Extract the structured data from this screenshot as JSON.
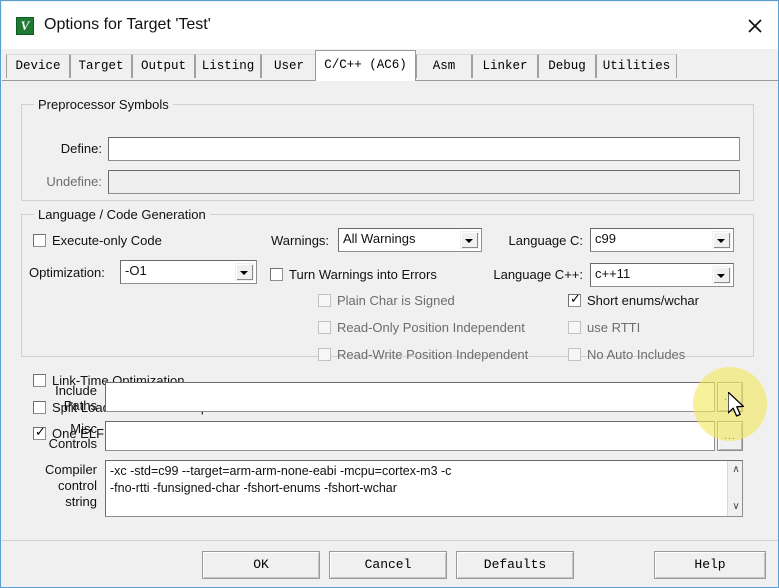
{
  "window": {
    "title": "Options for Target 'Test'",
    "icon_name": "uvision-app-icon",
    "icon_glyph": "V",
    "close_label": "✕",
    "accent_border": "#5a9fd4"
  },
  "tabs": [
    {
      "label": "Device",
      "active": false
    },
    {
      "label": "Target",
      "active": false
    },
    {
      "label": "Output",
      "active": false
    },
    {
      "label": "Listing",
      "active": false
    },
    {
      "label": "User",
      "active": false
    },
    {
      "label": "C/C++ (AC6)",
      "active": true
    },
    {
      "label": "Asm",
      "active": false
    },
    {
      "label": "Linker",
      "active": false
    },
    {
      "label": "Debug",
      "active": false
    },
    {
      "label": "Utilities",
      "active": false
    }
  ],
  "preprocessor": {
    "group_label": "Preprocessor Symbols",
    "define_label": "Define:",
    "define_value": "",
    "undefine_label": "Undefine:",
    "undefine_value": ""
  },
  "language": {
    "group_label": "Language / Code Generation",
    "execute_only_code": {
      "label": "Execute-only Code",
      "checked": false,
      "enabled": true
    },
    "optimization_label": "Optimization:",
    "optimization_value": "-O1",
    "link_time_optimization": {
      "label": "Link-Time Optimization",
      "checked": false,
      "enabled": true
    },
    "split_load_store": {
      "label": "Split Load and Store Multiple",
      "checked": false,
      "enabled": true
    },
    "one_elf_section": {
      "label": "One ELF Section per Function",
      "checked": true,
      "enabled": true
    },
    "warnings_label": "Warnings:",
    "warnings_value": "All Warnings",
    "turn_warnings_into_errors": {
      "label": "Turn Warnings into Errors",
      "checked": false,
      "enabled": true
    },
    "plain_char_is_signed": {
      "label": "Plain Char is Signed",
      "checked": false,
      "enabled": false
    },
    "read_only_position_independent": {
      "label": "Read-Only Position Independent",
      "checked": false,
      "enabled": false
    },
    "read_write_position_independent": {
      "label": "Read-Write Position Independent",
      "checked": false,
      "enabled": false
    },
    "language_c_label": "Language C:",
    "language_c_value": "c99",
    "language_cpp_label": "Language C++:",
    "language_cpp_value": "c++11",
    "short_enums_wchar": {
      "label": "Short enums/wchar",
      "checked": true,
      "enabled": true
    },
    "use_rtti": {
      "label": "use RTTI",
      "checked": false,
      "enabled": false
    },
    "no_auto_includes": {
      "label": "No Auto Includes",
      "checked": false,
      "enabled": false
    }
  },
  "paths": {
    "include_label_line1": "Include",
    "include_label_line2": "Paths",
    "include_value": "",
    "include_browse_label": "...",
    "misc_label_line1": "Misc",
    "misc_label_line2": "Controls",
    "misc_value": "",
    "misc_browse_label": "..."
  },
  "compiler": {
    "label_line1": "Compiler",
    "label_line2": "control",
    "label_line3": "string",
    "value_line1": "-xc -std=c99 --target=arm-arm-none-eabi -mcpu=cortex-m3 -c",
    "value_line2": "-fno-rtti -funsigned-char -fshort-enums -fshort-wchar",
    "scroll_up": "∧",
    "scroll_down": "∨"
  },
  "footer": {
    "ok": "OK",
    "cancel": "Cancel",
    "defaults": "Defaults",
    "help": "Help"
  },
  "highlight": {
    "name": "include-paths-browse-highlight",
    "color": "#f4e85e"
  }
}
